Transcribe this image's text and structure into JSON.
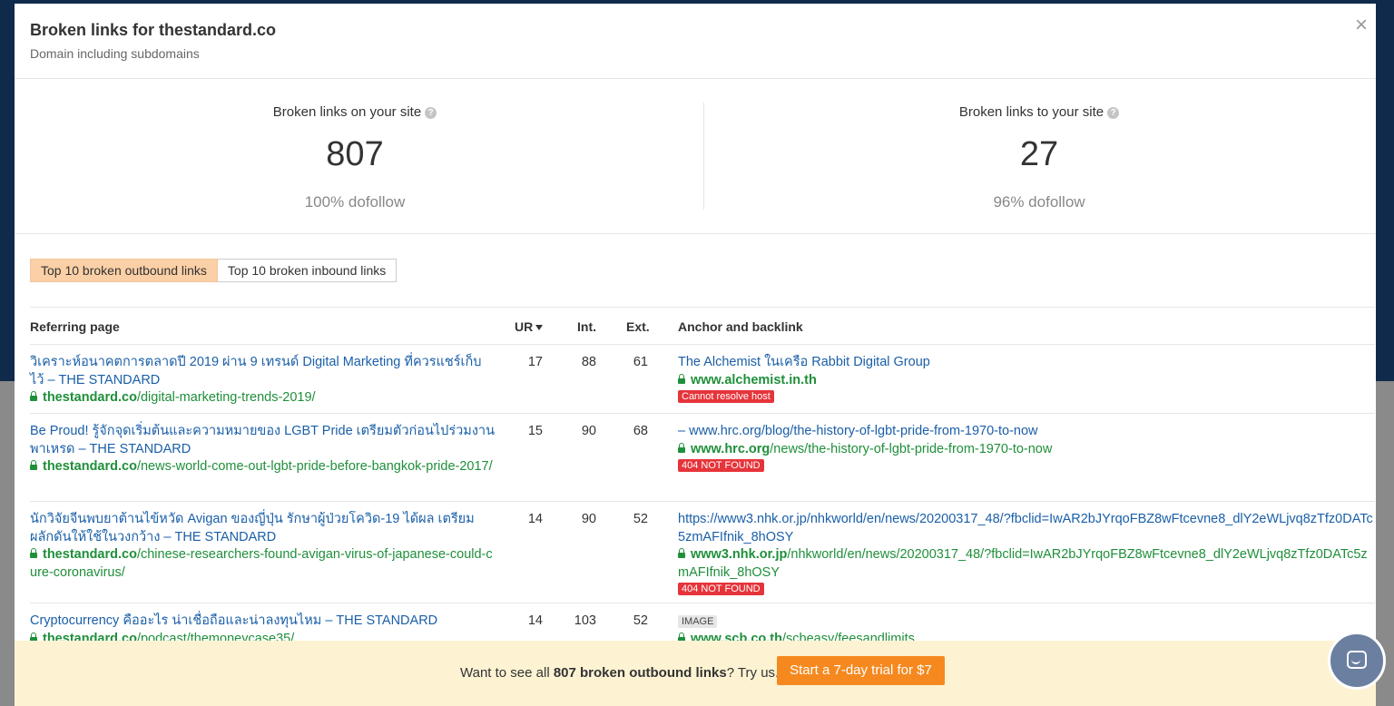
{
  "modal": {
    "title": "Broken links for thestandard.co",
    "subtitle": "Domain including subdomains",
    "close_label": "×"
  },
  "stats": {
    "outbound": {
      "label": "Broken links on your site",
      "value": "807",
      "sub": "100% dofollow"
    },
    "inbound": {
      "label": "Broken links to your site",
      "value": "27",
      "sub": "96% dofollow"
    },
    "help_glyph": "?"
  },
  "tabs": [
    {
      "label": "Top 10 broken outbound links",
      "active": true
    },
    {
      "label": "Top 10 broken inbound links",
      "active": false
    }
  ],
  "table": {
    "headers": {
      "referring": "Referring page",
      "ur": "UR",
      "int": "Int.",
      "ext": "Ext.",
      "anchor": "Anchor and backlink"
    },
    "rows": [
      {
        "ref_title": "วิเคราะห์อนาคตการตลาดปี 2019 ผ่าน 9 เทรนด์ Digital Marketing ที่ควรแชร์เก็บไว้ – THE STANDARD",
        "ref_domain": "thestandard.co",
        "ref_path": "/digital-marketing-trends-2019/",
        "ur": "17",
        "int": "88",
        "ext": "61",
        "anchor_text": "The Alchemist ในเครือ Rabbit Digital Group",
        "backlink_domain": "www.alchemist.in.th",
        "backlink_path": "",
        "status": "Cannot resolve host"
      },
      {
        "ref_title": "Be Proud! รู้จักจุดเริ่มต้นและความหมายของ LGBT Pride เตรียมตัวก่อนไปร่วมงานพาเหรด – THE STANDARD",
        "ref_domain": "thestandard.co",
        "ref_path": "/news-world-come-out-lgbt-pride-before-bangkok-pride-2017/",
        "ur": "15",
        "int": "90",
        "ext": "68",
        "anchor_text": "– www.hrc.org/blog/the-history-of-lgbt-pride-from-1970-to-now",
        "backlink_domain": "www.hrc.org",
        "backlink_path": "/news/the-history-of-lgbt-pride-from-1970-to-now",
        "status": "404 NOT FOUND"
      },
      {
        "ref_title": "นักวิจัยจีนพบยาต้านไข้หวัด Avigan ของญี่ปุ่น รักษาผู้ป่วยโควิด-19 ได้ผล เตรียมผลักดันให้ใช้ในวงกว้าง – THE STANDARD",
        "ref_domain": "thestandard.co",
        "ref_path": "/chinese-researchers-found-avigan-virus-of-japanese-could-cure-coronavirus/",
        "ur": "14",
        "int": "90",
        "ext": "52",
        "anchor_text": "https://www3.nhk.or.jp/nhkworld/en/news/20200317_48/?fbclid=IwAR2bJYrqoFBZ8wFtcevne8_dlY2eWLjvq8zTfz0DATc5zmAFIfnik_8hOSY",
        "backlink_domain": "www3.nhk.or.jp",
        "backlink_path": "/nhkworld/en/news/20200317_48/?fbclid=IwAR2bJYrqoFBZ8wFtcevne8_dlY2eWLjvq8zTfz0DATc5zmAFIfnik_8hOSY",
        "status": "404 NOT FOUND"
      },
      {
        "ref_title": "Cryptocurrency คืออะไร น่าเชื่อถือและน่าลงทุนไหม – THE STANDARD",
        "ref_domain": "thestandard.co",
        "ref_path": "/podcast/themoneycase35/",
        "ur": "14",
        "int": "103",
        "ext": "52",
        "anchor_tag": "IMAGE",
        "backlink_domain": "www.scb.co.th",
        "backlink_path": "/scbeasy/feesandlimits"
      }
    ]
  },
  "promo": {
    "text_before": "Want to see all ",
    "count_text": "807 broken outbound links",
    "text_after": "? Try us.",
    "button_label": "Start a 7-day trial for $7"
  },
  "colors": {
    "accent_orange": "#f5891f",
    "link_blue": "#1a5fa8",
    "url_green": "#1f8f3a",
    "error_red": "#e5343a",
    "active_tab": "#fbd0a6",
    "promo_bg": "#fdf3d3"
  },
  "icons": [
    "close-icon",
    "help-icon",
    "sort-desc-icon",
    "lock-icon",
    "chat-icon"
  ]
}
